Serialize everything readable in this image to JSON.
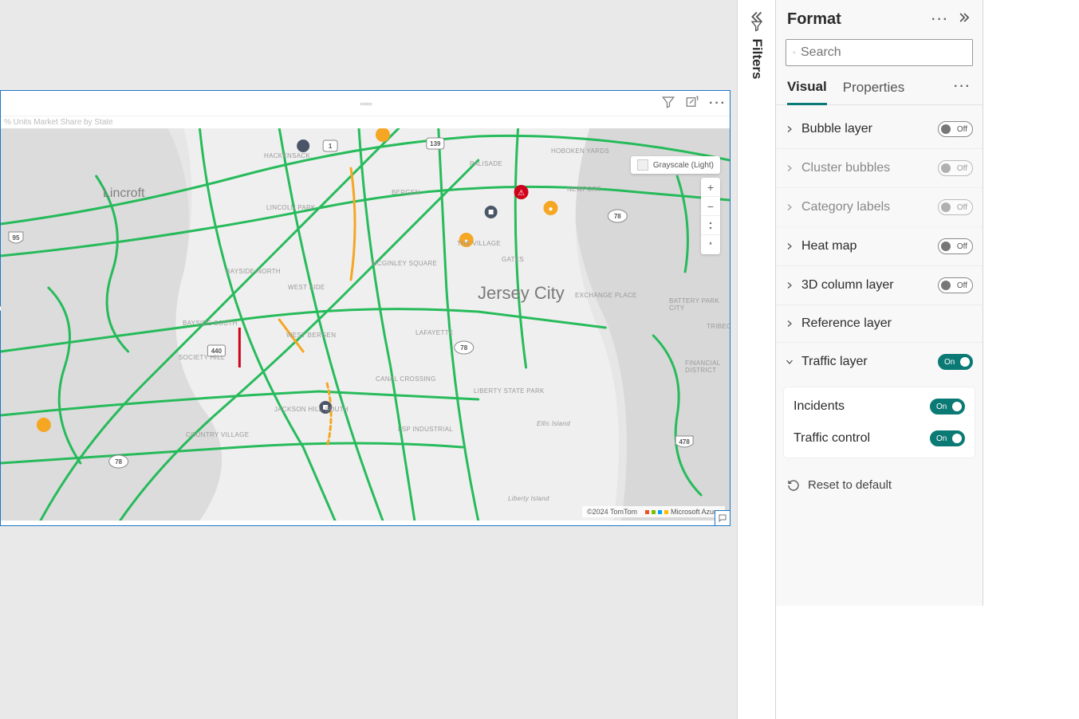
{
  "canvas": {
    "visual_title": "% Units Market Share by State"
  },
  "map": {
    "city_label": "Jersey City",
    "lincroft_label": "Lincroft",
    "style_control": "Grayscale (Light)",
    "attribution_copyright": "©2024 TomTom",
    "attribution_provider": "Microsoft Azure",
    "neighborhoods": {
      "hackensack": "HACKENSACK",
      "palisade": "PALISADE",
      "hoboken": "HOBOKEN YARDS",
      "newport": "NEWPORT",
      "bergen": "BERGEN",
      "lincoln_park": "LINCOLN PARK",
      "mcginley": "MCGINLEY SQUARE",
      "village": "THE VILLAGE",
      "gates": "GATES",
      "bayside_north": "BAYSIDE-NORTH",
      "west_side": "WEST SIDE",
      "exchange": "EXCHANGE PLACE",
      "bayside_south": "BAYSIDE-SOUTH",
      "west_bergen": "WEST BERGEN",
      "lafayette": "LAFAYETTE",
      "battery": "BATTERY PARK CITY",
      "tribeca": "TRIBECA",
      "financial": "FINANCIAL DISTRICT",
      "society": "SOCIETY HILL",
      "canal": "CANAL CROSSING",
      "liberty_park": "LIBERTY STATE PARK",
      "jackson": "JACKSON HILL-SOUTH",
      "lsp": "LSP INDUSTRIAL",
      "ellis": "Ellis Island",
      "country": "COUNTRY VILLAGE",
      "liberty_island": "Liberty Island"
    },
    "routes": {
      "r1": "1",
      "r139": "139",
      "r78a": "78",
      "r78b": "78",
      "r78c": "78",
      "r95": "95",
      "r440": "440",
      "r478": "478"
    },
    "zoom": {
      "in": "+",
      "out": "−",
      "pitch": "⤧"
    }
  },
  "filters": {
    "label": "Filters"
  },
  "format_pane": {
    "title": "Format",
    "search_placeholder": "Search",
    "tabs": {
      "visual": "Visual",
      "properties": "Properties"
    },
    "settings": {
      "bubble_layer": "Bubble layer",
      "cluster_bubbles": "Cluster bubbles",
      "category_labels": "Category labels",
      "heat_map": "Heat map",
      "column_layer": "3D column layer",
      "reference_layer": "Reference layer",
      "traffic_layer": "Traffic layer",
      "incidents": "Incidents",
      "traffic_control": "Traffic control"
    },
    "toggle": {
      "on": "On",
      "off": "Off"
    },
    "reset": "Reset to default"
  }
}
